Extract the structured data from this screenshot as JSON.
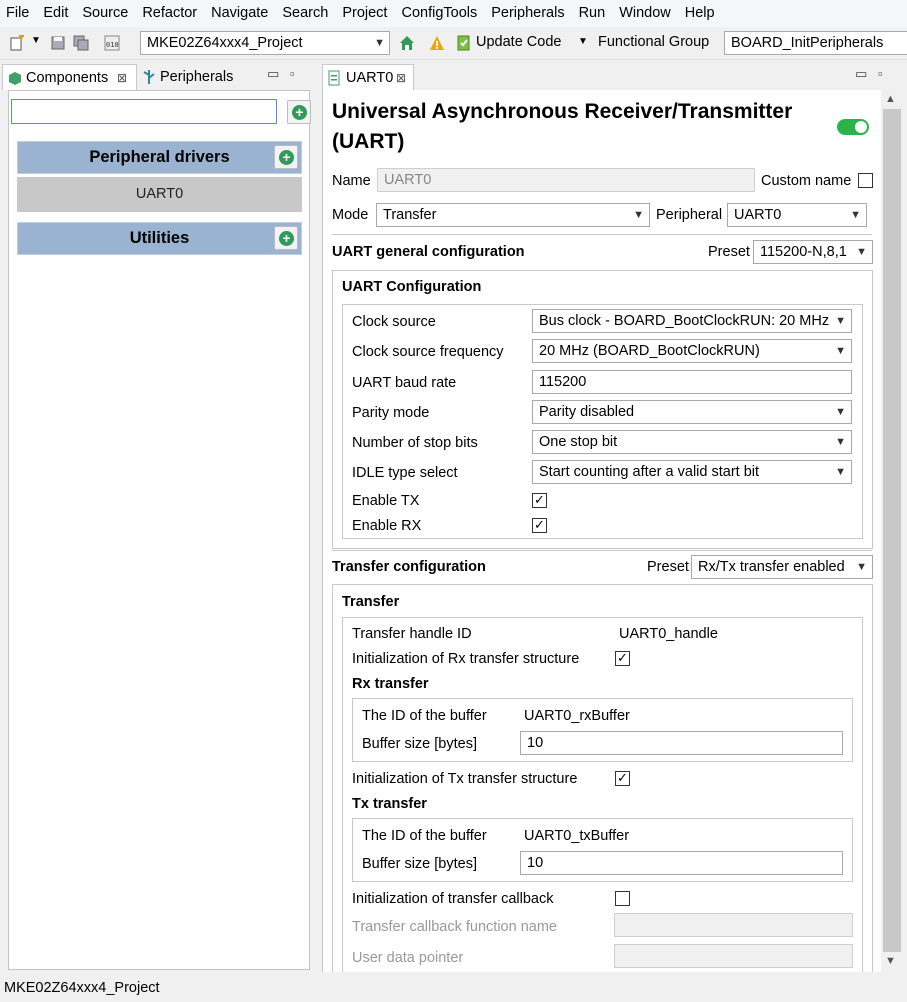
{
  "menu": [
    "File",
    "Edit",
    "Source",
    "Refactor",
    "Navigate",
    "Search",
    "Project",
    "ConfigTools",
    "Peripherals",
    "Run",
    "Window",
    "Help"
  ],
  "toolbar": {
    "project_select": "MKE02Z64xxx4_Project",
    "update_code_label": "Update Code",
    "functional_group_label": "Functional Group",
    "functional_group_value": "BOARD_InitPeripherals"
  },
  "left": {
    "tabs": {
      "components": "Components",
      "peripherals": "Peripherals"
    },
    "search_value": "",
    "groups": {
      "peripheral_drivers": "Peripheral drivers",
      "uart0_item": "UART0",
      "utilities": "Utilities"
    }
  },
  "right": {
    "tab_label": "UART0",
    "title_line1": "Universal Asynchronous Receiver/Transmitter",
    "title_line2": "(UART)",
    "name_label": "Name",
    "name_value": "UART0",
    "custom_name_label": "Custom name",
    "mode_label": "Mode",
    "mode_value": "Transfer",
    "peripheral_label": "Peripheral",
    "peripheral_value": "UART0",
    "general": {
      "heading": "UART general configuration",
      "preset_label": "Preset",
      "preset_value": "115200-N,8,1",
      "box_title": "UART Configuration",
      "clock_source_label": "Clock source",
      "clock_source_value": "Bus clock - BOARD_BootClockRUN: 20 MHz",
      "clock_freq_label": "Clock source frequency",
      "clock_freq_value": "20 MHz (BOARD_BootClockRUN)",
      "baud_label": "UART baud rate",
      "baud_value": "115200",
      "parity_label": "Parity mode",
      "parity_value": "Parity disabled",
      "stop_bits_label": "Number of stop bits",
      "stop_bits_value": "One stop bit",
      "idle_label": "IDLE type select",
      "idle_value": "Start counting after a valid start bit",
      "enable_tx_label": "Enable TX",
      "enable_rx_label": "Enable RX"
    },
    "transfer": {
      "heading": "Transfer configuration",
      "preset_label": "Preset",
      "preset_value": "Rx/Tx transfer enabled",
      "box_title": "Transfer",
      "handle_label": "Transfer handle ID",
      "handle_value": "UART0_handle",
      "init_rx_label": "Initialization of Rx transfer structure",
      "rx_title": "Rx transfer",
      "rx_buffer_id_label": "The ID of the buffer",
      "rx_buffer_id_value": "UART0_rxBuffer",
      "rx_size_label": "Buffer size [bytes]",
      "rx_size_value": "10",
      "init_tx_label": "Initialization of Tx transfer structure",
      "tx_title": "Tx transfer",
      "tx_buffer_id_label": "The ID of the buffer",
      "tx_buffer_id_value": "UART0_txBuffer",
      "tx_size_label": "Buffer size [bytes]",
      "tx_size_value": "10",
      "init_callback_label": "Initialization of transfer callback",
      "callback_name_label": "Transfer callback function name",
      "user_data_label": "User data pointer"
    }
  },
  "status": {
    "text": "MKE02Z64xxx4_Project"
  },
  "icons": [
    "new-file-icon",
    "save-icon",
    "save-all-icon",
    "binary-icon",
    "home-icon",
    "warning-icon",
    "update-code-icon",
    "components-tab-icon",
    "peripherals-tab-icon",
    "uart-tab-icon"
  ],
  "colors": {
    "accent_green": "#2ab34b",
    "group_bar": "#99b3d0",
    "selected_item": "#c8c8c8"
  }
}
